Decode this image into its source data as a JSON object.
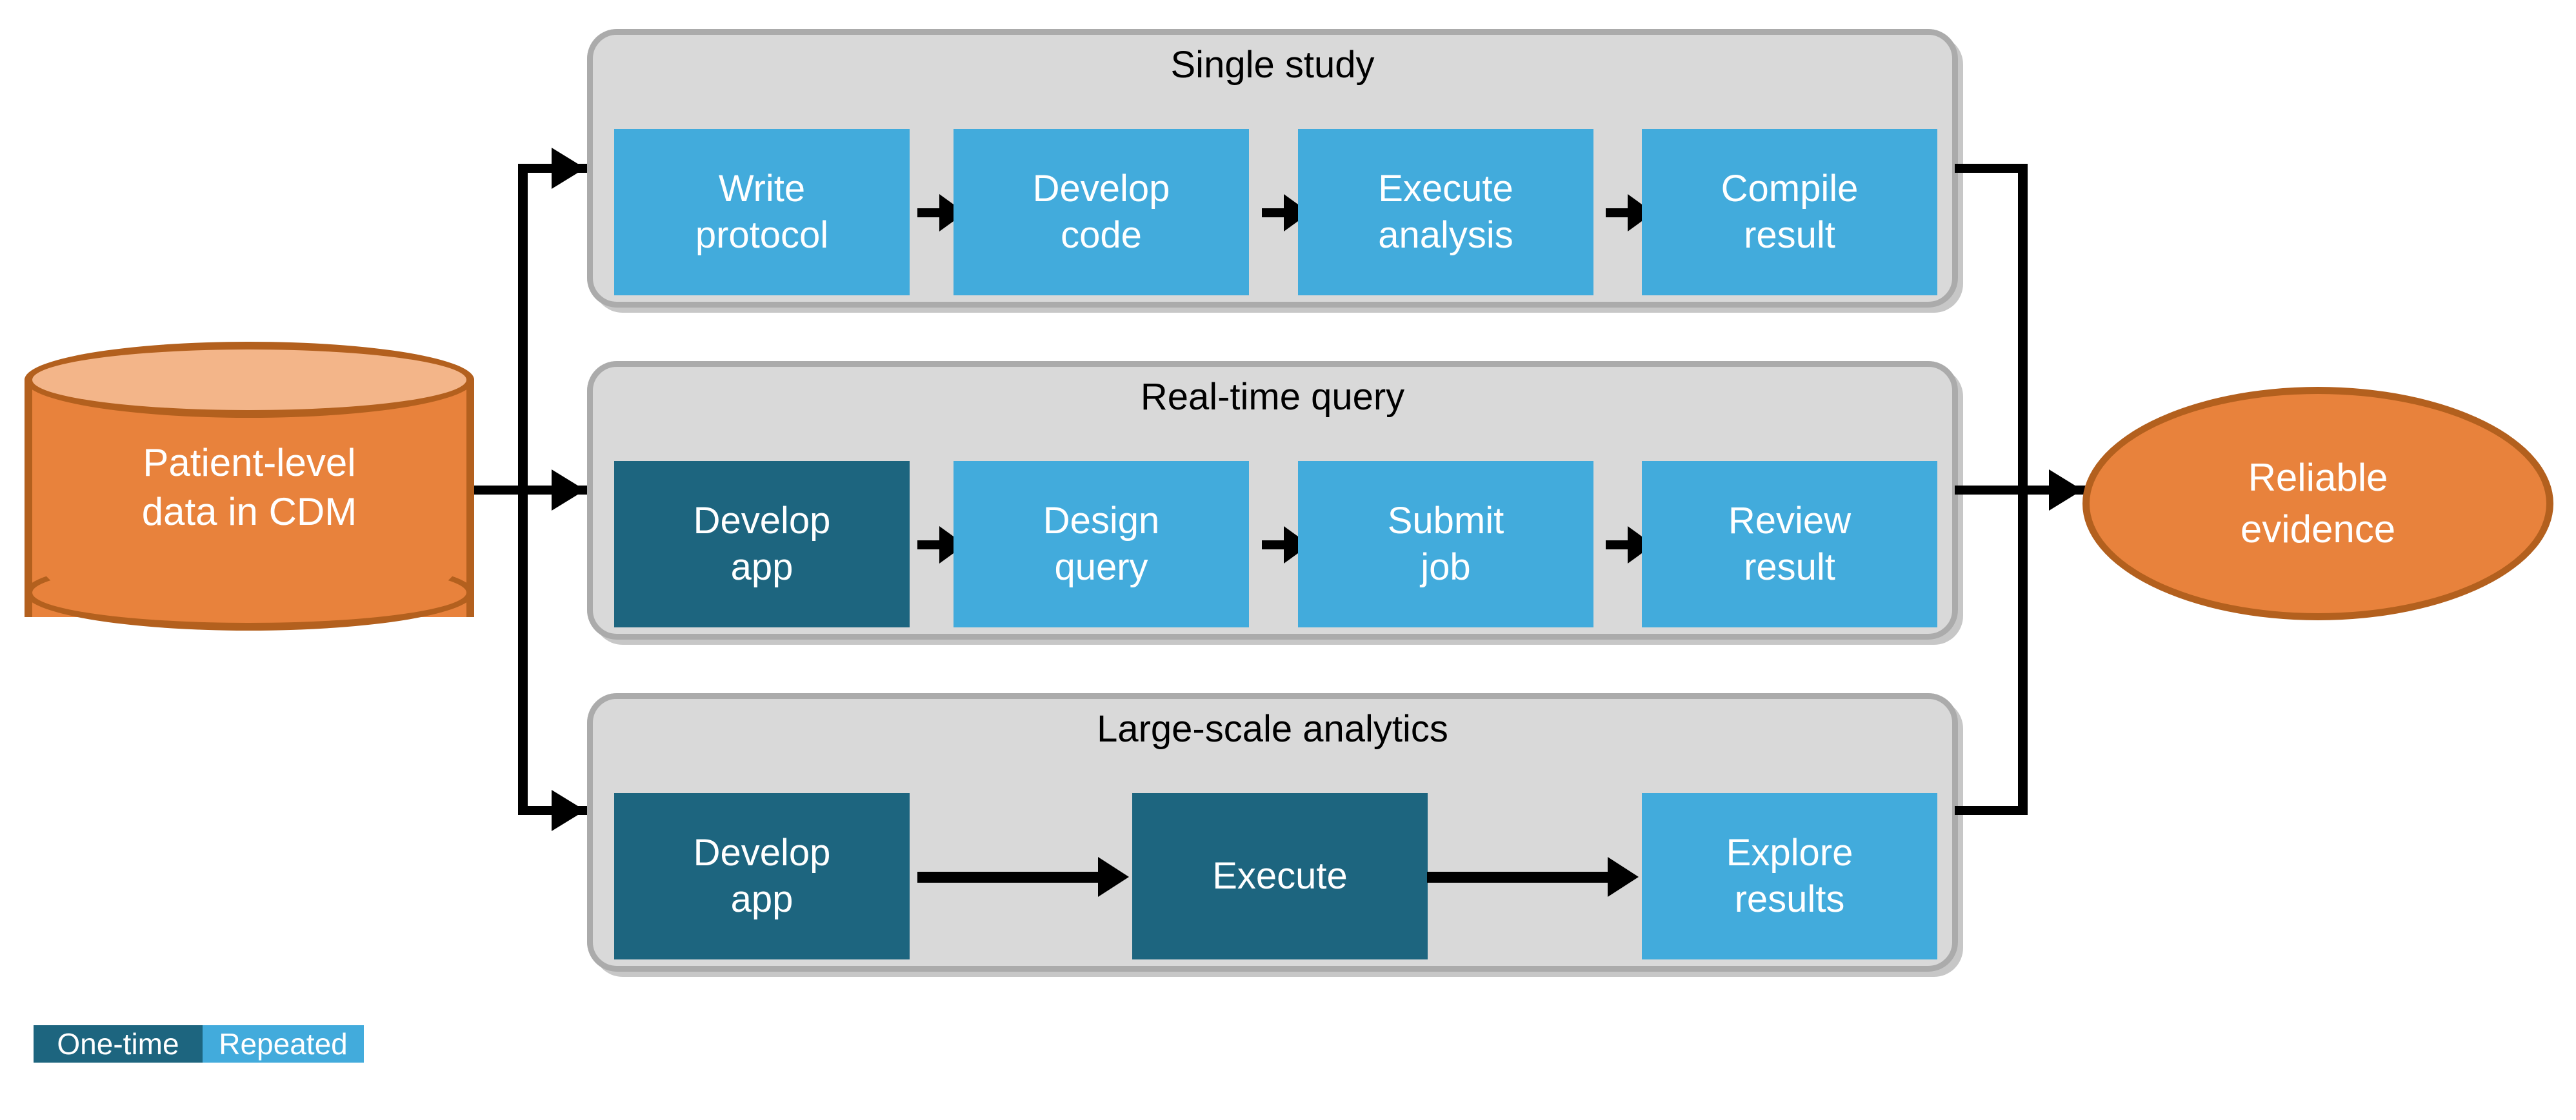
{
  "source": {
    "name": "patient-level-data-cylinder",
    "line1": "Patient-level",
    "line2": "data in CDM"
  },
  "outcome": {
    "name": "reliable-evidence-ellipse",
    "line1": "Reliable",
    "line2": "evidence"
  },
  "lanes": [
    {
      "title": "Single study",
      "steps": [
        {
          "line1": "Write",
          "line2": "protocol",
          "kind": "repeated"
        },
        {
          "line1": "Develop",
          "line2": "code",
          "kind": "repeated"
        },
        {
          "line1": "Execute",
          "line2": "analysis",
          "kind": "repeated"
        },
        {
          "line1": "Compile",
          "line2": "result",
          "kind": "repeated"
        }
      ]
    },
    {
      "title": "Real-time query",
      "steps": [
        {
          "line1": "Develop",
          "line2": "app",
          "kind": "one-time"
        },
        {
          "line1": "Design",
          "line2": "query",
          "kind": "repeated"
        },
        {
          "line1": "Submit",
          "line2": "job",
          "kind": "repeated"
        },
        {
          "line1": "Review",
          "line2": "result",
          "kind": "repeated"
        }
      ]
    },
    {
      "title": "Large-scale analytics",
      "steps": [
        {
          "line1": "Develop",
          "line2": "app",
          "kind": "one-time"
        },
        {
          "line1": "Execute",
          "line2": "",
          "kind": "one-time"
        },
        {
          "line1": "Explore",
          "line2": "results",
          "kind": "repeated"
        }
      ]
    }
  ],
  "legend": {
    "one_time": "One-time",
    "repeated": "Repeated"
  },
  "colors": {
    "repeated": "#42ABDC",
    "one_time": "#1D657F",
    "lane_background": "#D9D9D9",
    "lane_border": "#ABABAB",
    "data_orange": "#E8823C",
    "data_orange_light": "#F3B589",
    "data_orange_border": "#B3601E",
    "connector": "#000000",
    "text_on_fill": "#FFFFFF"
  }
}
